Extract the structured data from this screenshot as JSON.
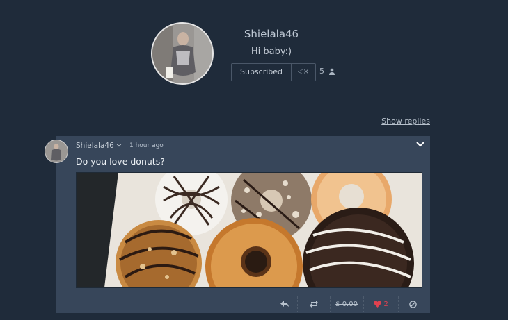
{
  "profile": {
    "username": "Shielala46",
    "bio": "Hi baby:)",
    "subscribe_label": "Subscribed",
    "mute_icon": "speaker-muted-icon",
    "subscriber_count": "5",
    "subscriber_icon": "person-icon"
  },
  "thread": {
    "show_replies_label": "Show replies"
  },
  "post": {
    "author": "Shielala46",
    "time": "1 hour ago",
    "text": "Do you love donuts?",
    "image_subject": "donuts-photo",
    "actions": {
      "reply_icon": "reply-icon",
      "repost_icon": "repost-icon",
      "tip_label": "$ 0.00",
      "likes_count": "2",
      "like_icon": "heart-icon",
      "block_icon": "block-icon"
    }
  },
  "colors": {
    "background": "#1f2b3a",
    "card": "#37465a",
    "like": "#e0414f"
  }
}
